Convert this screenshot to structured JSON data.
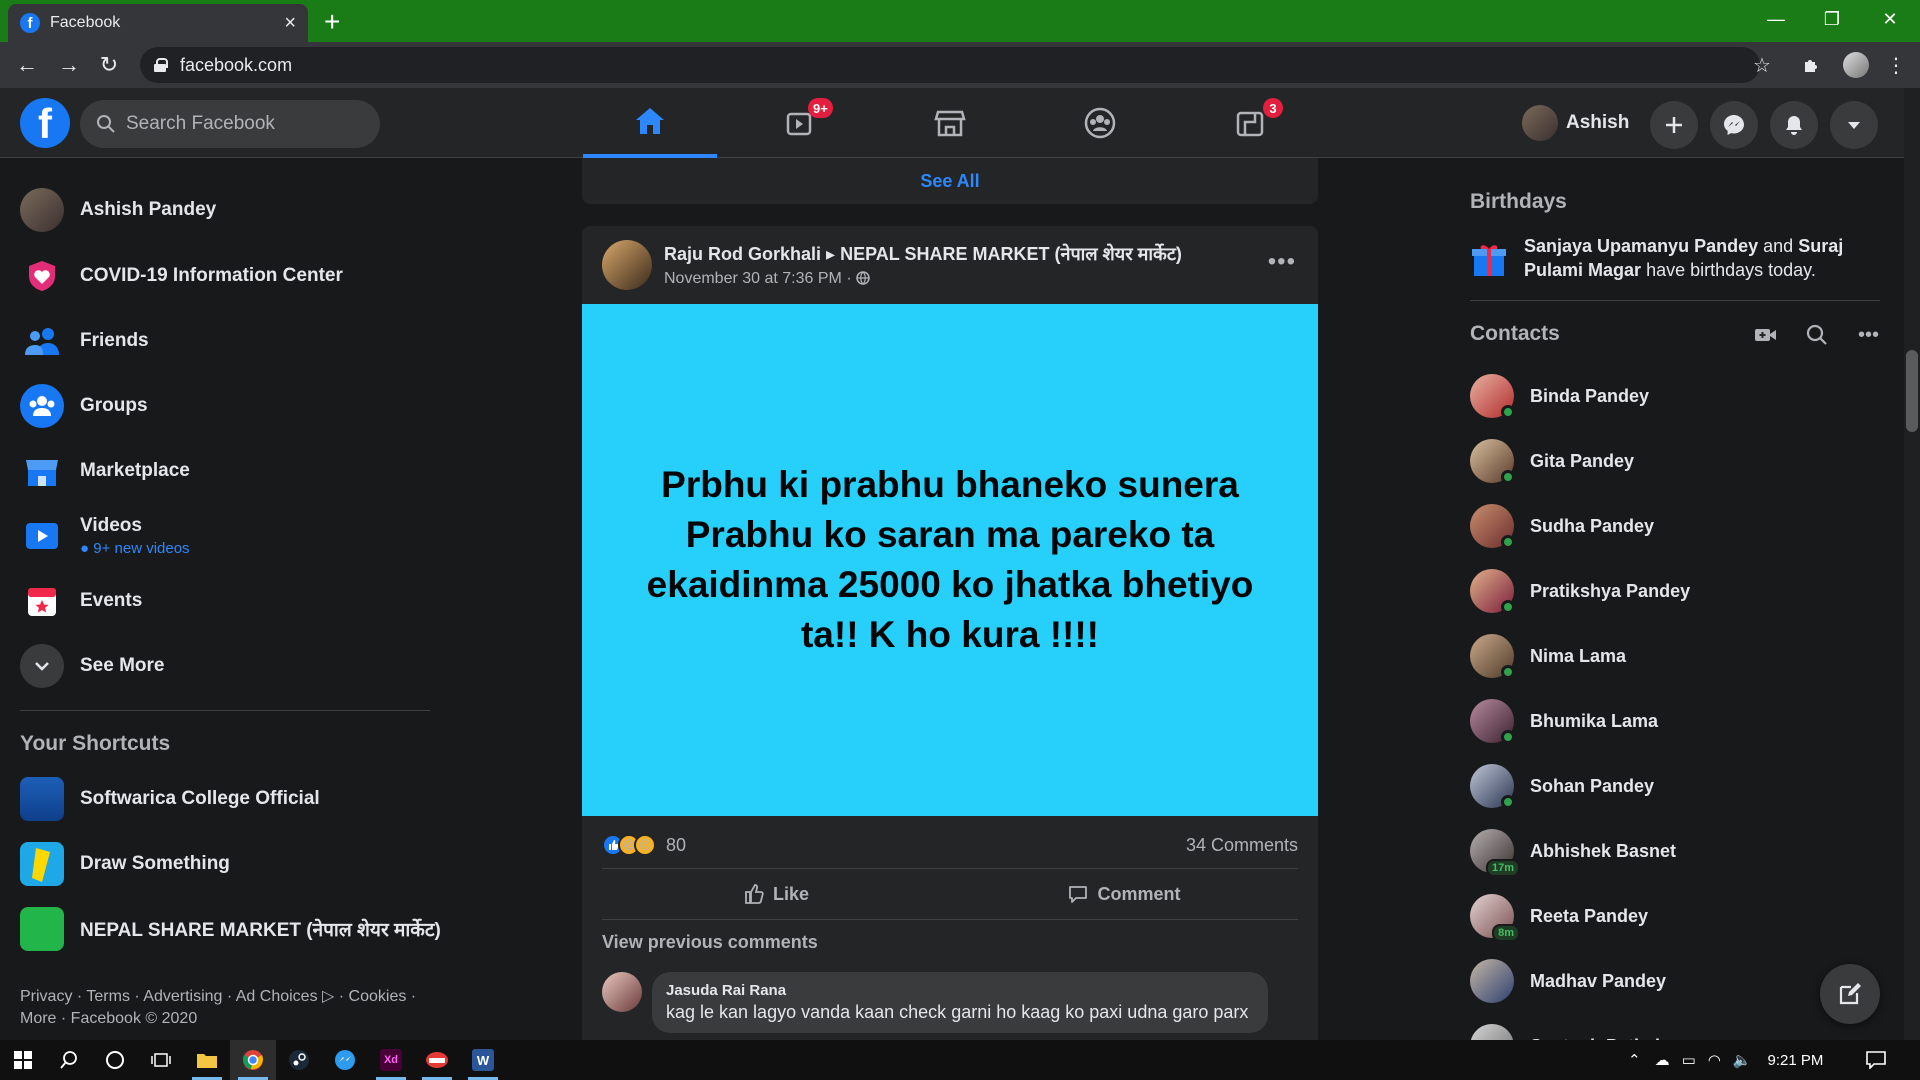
{
  "browser": {
    "tab_title": "Facebook",
    "url": "facebook.com"
  },
  "header": {
    "search_placeholder": "Search Facebook",
    "watch_badge": "9+",
    "gaming_badge": "3",
    "profile_name": "Ashish"
  },
  "left_nav": {
    "items": [
      {
        "label": "Ashish Pandey"
      },
      {
        "label": "COVID-19 Information Center"
      },
      {
        "label": "Friends"
      },
      {
        "label": "Groups"
      },
      {
        "label": "Marketplace"
      },
      {
        "label": "Videos",
        "sub": "9+ new videos"
      },
      {
        "label": "Events"
      },
      {
        "label": "See More"
      }
    ],
    "shortcuts_title": "Your Shortcuts",
    "shortcuts": [
      {
        "label": "Softwarica College Official"
      },
      {
        "label": "Draw Something"
      },
      {
        "label": "NEPAL SHARE MARKET (नेपाल शेयर मार्केट)"
      }
    ],
    "footer_line1": "Privacy · Terms · Advertising · Ad Choices ▷ · Cookies ·",
    "footer_line2": "More · Facebook © 2020"
  },
  "feed": {
    "see_all": "See All",
    "post": {
      "author": "Raju Rod Gorkhali",
      "arrow": "▸",
      "group": "NEPAL SHARE MARKET (नेपाल शेयर मार्केट)",
      "timestamp": "November 30 at 7:36 PM ·",
      "body": "Prbhu ki prabhu bhaneko sunera Prabhu ko saran ma pareko ta ekaidinma 25000 ko jhatka bhetiyo ta!! K ho kura !!!!",
      "reaction_count": "80",
      "comment_count": "34 Comments",
      "like_label": "Like",
      "comment_label": "Comment",
      "view_previous": "View previous comments",
      "comment": {
        "name": "Jasuda Rai Rana",
        "text": "kag le kan lagyo vanda kaan check garni ho kaag ko paxi udna garo parx"
      }
    }
  },
  "right": {
    "birthdays_title": "Birthdays",
    "birthday_name1": "Sanjaya Upamanyu Pandey",
    "birthday_and": "and",
    "birthday_name2": "Suraj Pulami Magar",
    "birthday_suffix": "have birthdays today.",
    "contacts_title": "Contacts",
    "contacts": [
      {
        "name": "Binda Pandey",
        "status": "online"
      },
      {
        "name": "Gita Pandey",
        "status": "online"
      },
      {
        "name": "Sudha Pandey",
        "status": "online"
      },
      {
        "name": "Pratikshya Pandey",
        "status": "online"
      },
      {
        "name": "Nima Lama",
        "status": "online"
      },
      {
        "name": "Bhumika Lama",
        "status": "online"
      },
      {
        "name": "Sohan Pandey",
        "status": "online"
      },
      {
        "name": "Abhishek Basnet",
        "status": "17m"
      },
      {
        "name": "Reeta Pandey",
        "status": "8m"
      },
      {
        "name": "Madhav Pandey",
        "status": "none"
      },
      {
        "name": "Santosh Pathak",
        "status": "none"
      }
    ]
  },
  "taskbar": {
    "time": "9:21 PM"
  },
  "colors": {
    "fb_blue": "#1877f2",
    "accent_link": "#2d88ff",
    "post_bg": "#26d0fb",
    "tab_strip": "#197c16"
  }
}
